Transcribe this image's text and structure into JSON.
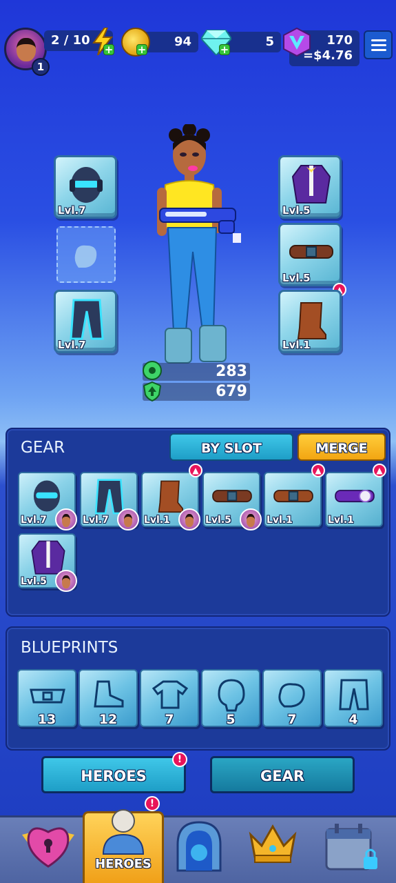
{
  "topbar": {
    "player_level": "1",
    "energy": "2 / 10",
    "coins": "94",
    "gems": "5",
    "v_tokens": "170",
    "v_value": "=$4.76",
    "plus": "+"
  },
  "hero": {
    "equipped_left": [
      {
        "item": "helmet",
        "level": "Lvl.7"
      },
      {
        "item": "gloves-empty",
        "level": ""
      },
      {
        "item": "pants",
        "level": "Lvl.7"
      }
    ],
    "equipped_right": [
      {
        "item": "jacket",
        "level": "Lvl.5"
      },
      {
        "item": "belt",
        "level": "Lvl.5"
      },
      {
        "item": "boots",
        "level": "Lvl.1"
      }
    ],
    "attack_power": "283",
    "health": "679"
  },
  "gear": {
    "title": "GEAR",
    "tab_by_slot": "BY SLOT",
    "tab_merge": "MERGE",
    "items": [
      {
        "item": "helmet",
        "level": "Lvl.7",
        "equipped": true,
        "upgrade": false
      },
      {
        "item": "pants",
        "level": "Lvl.7",
        "equipped": true,
        "upgrade": false
      },
      {
        "item": "boots",
        "level": "Lvl.1",
        "equipped": true,
        "upgrade": true
      },
      {
        "item": "belt",
        "level": "Lvl.5",
        "equipped": true,
        "upgrade": false
      },
      {
        "item": "belt",
        "level": "Lvl.1",
        "equipped": false,
        "upgrade": true
      },
      {
        "item": "purple-belt",
        "level": "Lvl.1",
        "equipped": false,
        "upgrade": true
      },
      {
        "item": "jacket",
        "level": "Lvl.5",
        "equipped": true,
        "upgrade": false
      }
    ]
  },
  "blueprints": {
    "title": "BLUEPRINTS",
    "items": [
      {
        "item": "belt-blueprint",
        "count": "13"
      },
      {
        "item": "boot-blueprint",
        "count": "12"
      },
      {
        "item": "shirt-blueprint",
        "count": "7"
      },
      {
        "item": "helmet-blueprint",
        "count": "5"
      },
      {
        "item": "glove-blueprint",
        "count": "7"
      },
      {
        "item": "pants-blueprint",
        "count": "4"
      }
    ]
  },
  "buttons": {
    "heroes": "HEROES",
    "gear": "GEAR",
    "alert": "!"
  },
  "nav": {
    "active_label": "HEROES",
    "items": [
      "heart-key",
      "heroes",
      "portal",
      "crown",
      "calendar"
    ]
  },
  "colors": {
    "accent_gold": "#f2a512",
    "accent_cyan": "#3fc7e8",
    "alert_red": "#e8145a"
  }
}
